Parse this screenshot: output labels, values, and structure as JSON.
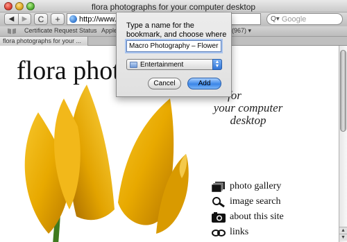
{
  "window": {
    "title": "flora photographs for your computer desktop"
  },
  "toolbar": {
    "back_glyph": "◀",
    "forward_glyph": "▶",
    "reload_glyph": "C",
    "add_glyph": "+",
    "address": "http://www.flo",
    "search_placeholder": "Google",
    "search_glyph": "Q▾"
  },
  "bookmarks_bar": {
    "items": [
      {
        "label": "Certificate Request Status"
      },
      {
        "label": "Apple"
      },
      {
        "label": "(967) ▾"
      }
    ]
  },
  "tabs": [
    {
      "label": "flora photographs for your ..."
    }
  ],
  "page": {
    "title": "flora photo",
    "tagline": [
      "for",
      "your computer",
      "desktop"
    ],
    "nav": [
      {
        "label": "photo gallery",
        "icon": "gallery-icon"
      },
      {
        "label": "image search",
        "icon": "magnifier-icon"
      },
      {
        "label": "about this site",
        "icon": "camera-icon"
      },
      {
        "label": "links",
        "icon": "link-icon"
      }
    ]
  },
  "bookmark_sheet": {
    "prompt": "Type a name for the bookmark, and choose where to keep it.",
    "name_value": "Macro Photography – Flowers",
    "folder_selected": "Entertainment",
    "cancel_label": "Cancel",
    "add_label": "Add"
  },
  "colors": {
    "accent_blue": "#3b86e8",
    "flower_yellow": "#e8a900"
  }
}
